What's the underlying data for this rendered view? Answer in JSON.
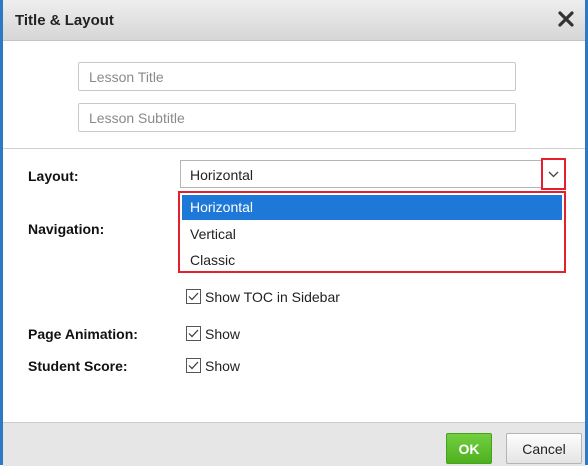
{
  "dialog": {
    "title": "Title & Layout",
    "close_icon": "close-icon"
  },
  "fields": {
    "lesson_title": {
      "value": "",
      "placeholder": "Lesson Title"
    },
    "lesson_subtitle": {
      "value": "",
      "placeholder": "Lesson Subtitle"
    }
  },
  "layout": {
    "label": "Layout:",
    "selected": "Horizontal",
    "arrow_icon": "chevron-down-icon",
    "options": [
      "Horizontal",
      "Vertical",
      "Classic"
    ]
  },
  "navigation": {
    "label": "Navigation:",
    "toc_label": "Show TOC in Sidebar",
    "toc_checked": true
  },
  "page_animation": {
    "label": "Page Animation:",
    "show_label": "Show",
    "checked": true
  },
  "student_score": {
    "label": "Student Score:",
    "show_label": "Show",
    "checked": true
  },
  "footer": {
    "ok_label": "OK",
    "cancel_label": "Cancel"
  },
  "colors": {
    "accent_border": "#2f78c4",
    "highlight": "#e5202e",
    "selected_option": "#1e78d7",
    "ok_button": "#5bbd2b"
  }
}
